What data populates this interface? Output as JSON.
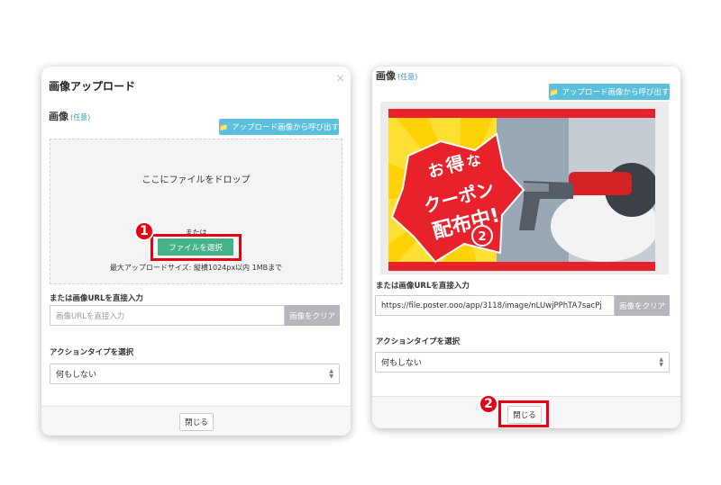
{
  "modal_left": {
    "title": "画像アップロード",
    "close_icon": "×",
    "image_label": "画像",
    "optional_tag": "(任意)",
    "upload_library_button": "アップロード画像から呼び出す",
    "dropzone_text": "ここにファイルをドロップ",
    "or_text": "または",
    "select_file_button": "ファイルを選択",
    "max_size_text": "最大アップロードサイズ: 縦横1024px以内 1MBまで",
    "url_label": "または画像URLを直接入力",
    "url_placeholder": "画像URLを直接入力",
    "clear_button": "画像をクリア",
    "action_label": "アクションタイプを選択",
    "action_value": "何もしない",
    "footer_close_button": "閉じる",
    "step_badge": "1"
  },
  "modal_right": {
    "image_label": "画像",
    "optional_tag": "(任意)",
    "upload_library_button": "アップロード画像から呼び出す",
    "banner_text": {
      "line1_a": "お",
      "line1_b": "得",
      "line1_c": "な",
      "line2": "クーポン",
      "line3": "配布中!"
    },
    "url_label": "または画像URLを直接入力",
    "url_value": "https://file.poster.ooo/app/3118/image/nLUwjPPhTA7sacPj",
    "clear_button": "画像をクリア",
    "action_label": "アクションタイプを選択",
    "action_value": "何もしない",
    "footer_close_button": "閉じる",
    "step_badge": "2",
    "banner_step_badge": "2"
  },
  "colors": {
    "accent_blue": "#5bc0de",
    "accent_green": "#46b28a",
    "highlight_red": "#e60012",
    "banner_red": "#e8222a",
    "banner_yellow": "#ffe033"
  },
  "icons": [
    "folder-icon",
    "close-icon",
    "select-arrows-icon"
  ]
}
